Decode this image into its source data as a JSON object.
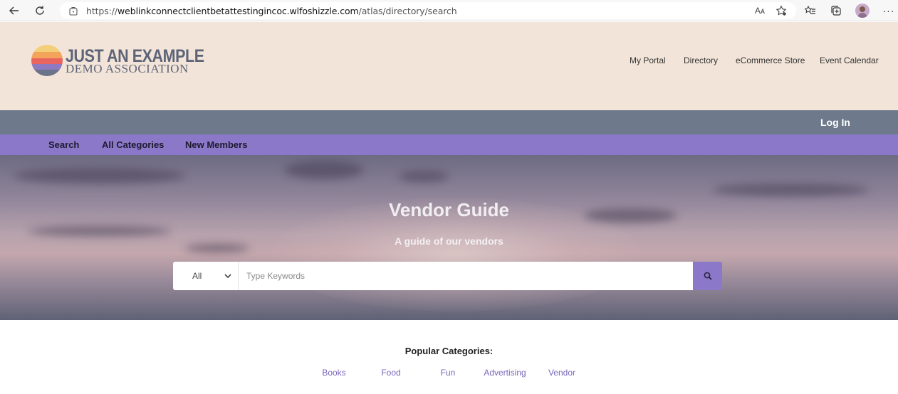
{
  "browser": {
    "url_prefix": "https://",
    "url_domain": "weblinkconnectclientbetattestingincoc.wlfoshizzle.com",
    "url_path": "/atlas/directory/search",
    "read_aloud_label": "Aᴀ"
  },
  "site": {
    "logo_line1": "JUST AN EXAMPLE",
    "logo_line2": "DEMO ASSOCIATION",
    "nav": [
      "My Portal",
      "Directory",
      "eCommerce Store",
      "Event Calendar"
    ],
    "login": "Log In",
    "subnav": [
      "Search",
      "All Categories",
      "New Members"
    ]
  },
  "hero": {
    "title": "Vendor Guide",
    "subtitle": "A guide of our vendors",
    "select_value": "All",
    "keywords_placeholder": "Type Keywords"
  },
  "popular": {
    "title": "Popular Categories:",
    "categories": [
      "Books",
      "Food",
      "Fun",
      "Advertising",
      "Vendor"
    ]
  },
  "colors": {
    "header_bg": "#f2e4d8",
    "login_bar": "#6e7a8c",
    "accent_purple": "#8c78c8",
    "category_link": "#7a68b8"
  },
  "icons": {
    "back": "back-arrow-icon",
    "refresh": "refresh-icon",
    "search": "magnifier-icon"
  }
}
